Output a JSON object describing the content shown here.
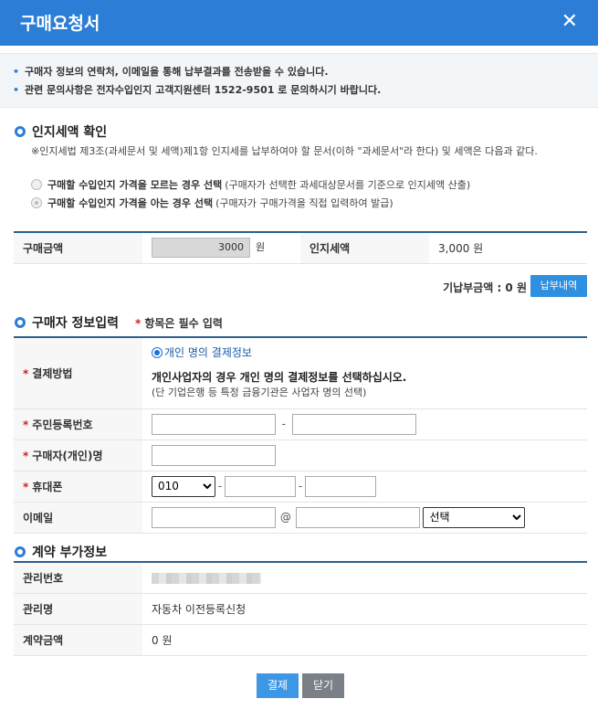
{
  "window": {
    "title": "구매요청서",
    "close_symbol": "✕"
  },
  "notices": [
    "구매자 정보의 연락처, 이메일을 통해 납부결과를 전송받을 수 있습니다.",
    "관련 문의사항은 전자수입인지 고객지원센터 1522-9501 로 문의하시기 바랍니다."
  ],
  "stamp_check": {
    "title": "인지세액 확인",
    "description": "※인지세법 제3조(과세문서 및 세액)제1항 인지세를 납부하여야 할 문서(이하 \"과세문서\"라 한다) 및 세액은 다음과 같다.",
    "options": [
      {
        "label": "구매할 수입인지 가격을 모르는 경우 선택",
        "hint": "(구매자가 선택한 과세대상문서를 기준으로 인지세액 산출)",
        "selected": false
      },
      {
        "label": "구매할 수입인지 가격을 아는 경우 선택",
        "hint": "(구매자가 구매가격을 직접 입력하여 발급)",
        "selected": true
      }
    ]
  },
  "amount": {
    "purchase_label": "구매금액",
    "purchase_value": "3000",
    "unit": "원",
    "tax_label": "인지세액",
    "tax_value": "3,000 원"
  },
  "paid": {
    "summary": "기납부금액 : 0 원",
    "history_button": "납부내역"
  },
  "buyer": {
    "title": "구매자 정보입력",
    "required_note": "항목은 필수 입력",
    "payment_method": {
      "label": "결제방법",
      "option": "개인 명의 결제정보",
      "instruction": "개인사업자의 경우 개인 명의 결제정보를 선택하십시오.",
      "note": "(단 기업은행 등 특정 금융기관은 사업자 명의 선택)"
    },
    "rrn_label": "주민등록번호",
    "rrn_separator": "-",
    "name_label": "구매자(개인)명",
    "phone": {
      "label": "휴대폰",
      "prefix": "010",
      "separator": "-"
    },
    "email": {
      "label": "이메일",
      "at": "@",
      "domain_select": "선택"
    }
  },
  "contract": {
    "title": "계약 부가정보",
    "mgmt_no_label": "관리번호",
    "mgmt_name_label": "관리명",
    "mgmt_name_value": "자동차 이전등록신청",
    "amount_label": "계약금액",
    "amount_value": "0 원"
  },
  "buttons": {
    "pay": "결제",
    "close": "닫기"
  },
  "colors": {
    "header": "#2c7dd6",
    "primary_button": "#3d97e6",
    "secondary_button": "#7b7f87",
    "required": "#d32020"
  }
}
